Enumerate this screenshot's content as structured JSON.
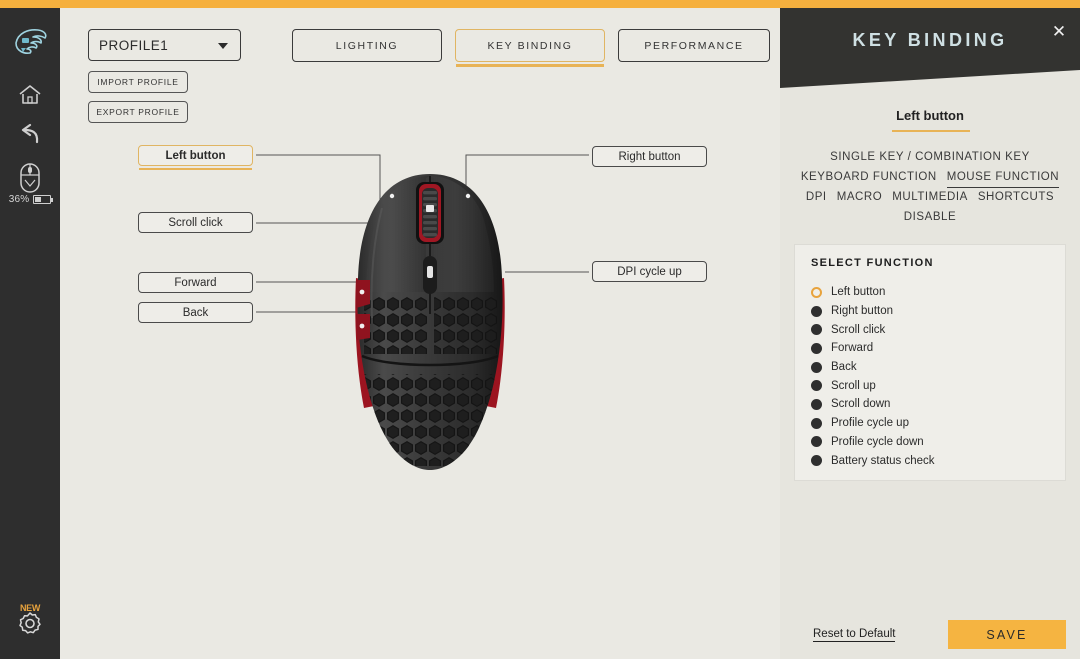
{
  "colors": {
    "accent": "#f5b03e",
    "sidebar_bg": "#2e2e2e",
    "main_bg": "#eae9e3",
    "panel_bg": "#e6e5de",
    "panel_header_bg": "#333330",
    "panel_title": "#cfe0e3",
    "save_bg": "#f5b441"
  },
  "sidebar": {
    "logo": "glorious-logo-icon",
    "items": [
      {
        "icon": "home-icon",
        "name": "home"
      },
      {
        "icon": "back-arrow-icon",
        "name": "back"
      },
      {
        "icon": "mouse-device-icon",
        "name": "device"
      }
    ],
    "battery": {
      "percent": "36%",
      "level": 36,
      "icon": "battery-icon"
    },
    "settings": {
      "icon": "gear-icon",
      "badge": "NEW"
    }
  },
  "toolbar": {
    "profile": {
      "value": "PROFILE1",
      "caret": "chevron-down-icon"
    },
    "import_label": "IMPORT PROFILE",
    "export_label": "EXPORT PROFILE"
  },
  "tabs": [
    {
      "label": "LIGHTING",
      "active": false
    },
    {
      "label": "KEY BINDING",
      "active": true
    },
    {
      "label": "PERFORMANCE",
      "active": false
    }
  ],
  "callouts": {
    "left_button": "Left button",
    "scroll_click": "Scroll click",
    "forward": "Forward",
    "back": "Back",
    "right_button": "Right button",
    "dpi_cycle_up": "DPI cycle up"
  },
  "panel": {
    "title": "KEY BINDING",
    "close_icon": "close-icon",
    "target": "Left button",
    "modes": [
      {
        "label": "SINGLE KEY / COMBINATION KEY",
        "active": false,
        "row": 0
      },
      {
        "label": "KEYBOARD FUNCTION",
        "active": false,
        "row": 1
      },
      {
        "label": "MOUSE FUNCTION",
        "active": true,
        "row": 1
      },
      {
        "label": "DPI",
        "active": false,
        "row": 2
      },
      {
        "label": "MACRO",
        "active": false,
        "row": 2
      },
      {
        "label": "MULTIMEDIA",
        "active": false,
        "row": 2
      },
      {
        "label": "SHORTCUTS",
        "active": false,
        "row": 2
      },
      {
        "label": "DISABLE",
        "active": false,
        "row": 3
      }
    ],
    "select_function": {
      "title": "SELECT FUNCTION",
      "options": [
        {
          "label": "Left button",
          "selected": true
        },
        {
          "label": "Right button",
          "selected": false
        },
        {
          "label": "Scroll click",
          "selected": false
        },
        {
          "label": "Forward",
          "selected": false
        },
        {
          "label": "Back",
          "selected": false
        },
        {
          "label": "Scroll up",
          "selected": false
        },
        {
          "label": "Scroll down",
          "selected": false
        },
        {
          "label": "Profile cycle up",
          "selected": false
        },
        {
          "label": "Profile cycle down",
          "selected": false
        },
        {
          "label": "Battery status check",
          "selected": false
        }
      ]
    },
    "reset_label": "Reset to Default",
    "save_label": "SAVE"
  }
}
